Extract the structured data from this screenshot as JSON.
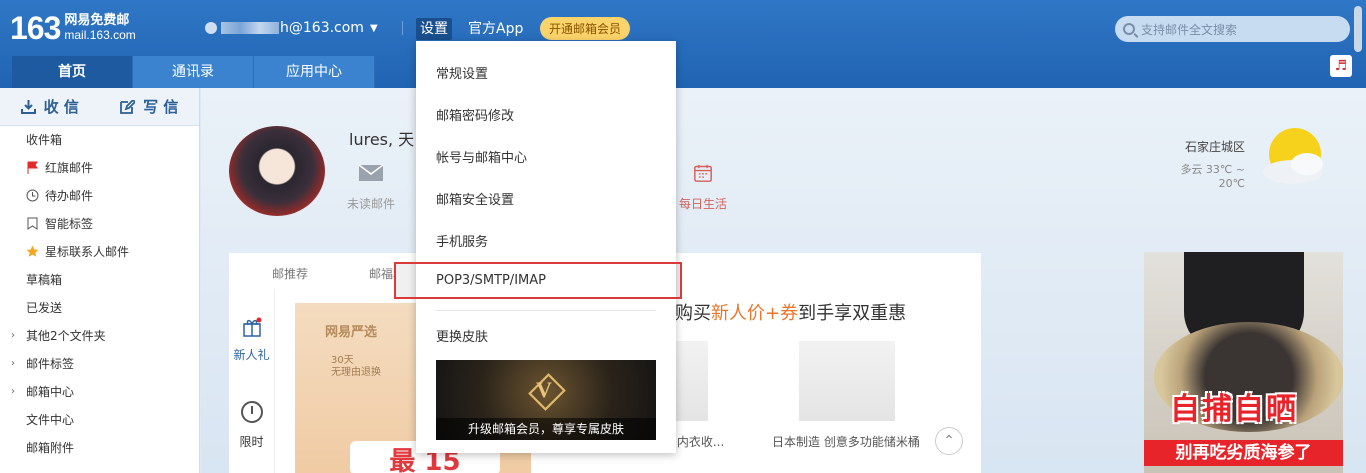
{
  "header": {
    "logo_num": "163",
    "logo_cn": "网易免费邮",
    "logo_domain": "mail.163.com",
    "account_prefix": "...",
    "account_suffix": "h@163.com",
    "settings": "设置",
    "official_app": "官方App",
    "vip": "开通邮箱会员",
    "search_placeholder": "支持邮件全文搜索"
  },
  "tabs": [
    {
      "label": "首页",
      "active": true
    },
    {
      "label": "通讯录"
    },
    {
      "label": "应用中心"
    }
  ],
  "sidebar": {
    "receive": "收 信",
    "write": "写 信",
    "folders": [
      {
        "label": "收件箱"
      },
      {
        "label": "红旗邮件",
        "icon": "flag-icon"
      },
      {
        "label": "待办邮件",
        "icon": "clock-icon"
      },
      {
        "label": "智能标签",
        "icon": "bookmark-icon"
      },
      {
        "label": "星标联系人邮件",
        "icon": "star-icon"
      },
      {
        "label": "草稿箱"
      },
      {
        "label": "已发送"
      },
      {
        "label": "其他2个文件夹",
        "expandable": true
      },
      {
        "label": "邮件标签",
        "expandable": true
      },
      {
        "label": "邮箱中心",
        "expandable": true
      },
      {
        "label": "文件中心"
      },
      {
        "label": "邮箱附件"
      }
    ]
  },
  "home": {
    "greeting": "lures, 天",
    "unread": "未读邮件",
    "daily": "每日生活",
    "weather_city": "石家庄城区",
    "weather_temp": "多云 33℃ ~ 20℃",
    "panel_tabs": [
      "邮推荐",
      "邮福利"
    ],
    "new_gift": "新人礼",
    "limited": "限时",
    "yanxuan_title": "网易严选",
    "yanxuan_badge_1_days": "30天",
    "yanxuan_badge_1_text": "无理由退换",
    "yanxuan_num": "最 15",
    "promo_head_pre": "购买",
    "promo_head_hl": "新人价+券",
    "promo_head_post": "到手享双重惠",
    "products": [
      {
        "caption": "麻涤·内衣收..."
      },
      {
        "caption": "日本制造 创意多功能储米桶"
      }
    ]
  },
  "ad": {
    "title": "自捕自晒",
    "subtitle": "别再吃劣质海参了"
  },
  "dropdown": {
    "items": [
      "常规设置",
      "邮箱密码修改",
      "帐号与邮箱中心",
      "邮箱安全设置",
      "手机服务",
      "POP3/SMTP/IMAP",
      "更换皮肤"
    ],
    "skin_caption": "升级邮箱会员，尊享专属皮肤",
    "skin_badge": "V"
  },
  "colors": {
    "header_blue": "#2063b2",
    "highlight_border": "#d93a3a",
    "vip_yellow": "#fbd36b",
    "accent_orange": "#e9762b",
    "ad_red": "#e8242b"
  }
}
